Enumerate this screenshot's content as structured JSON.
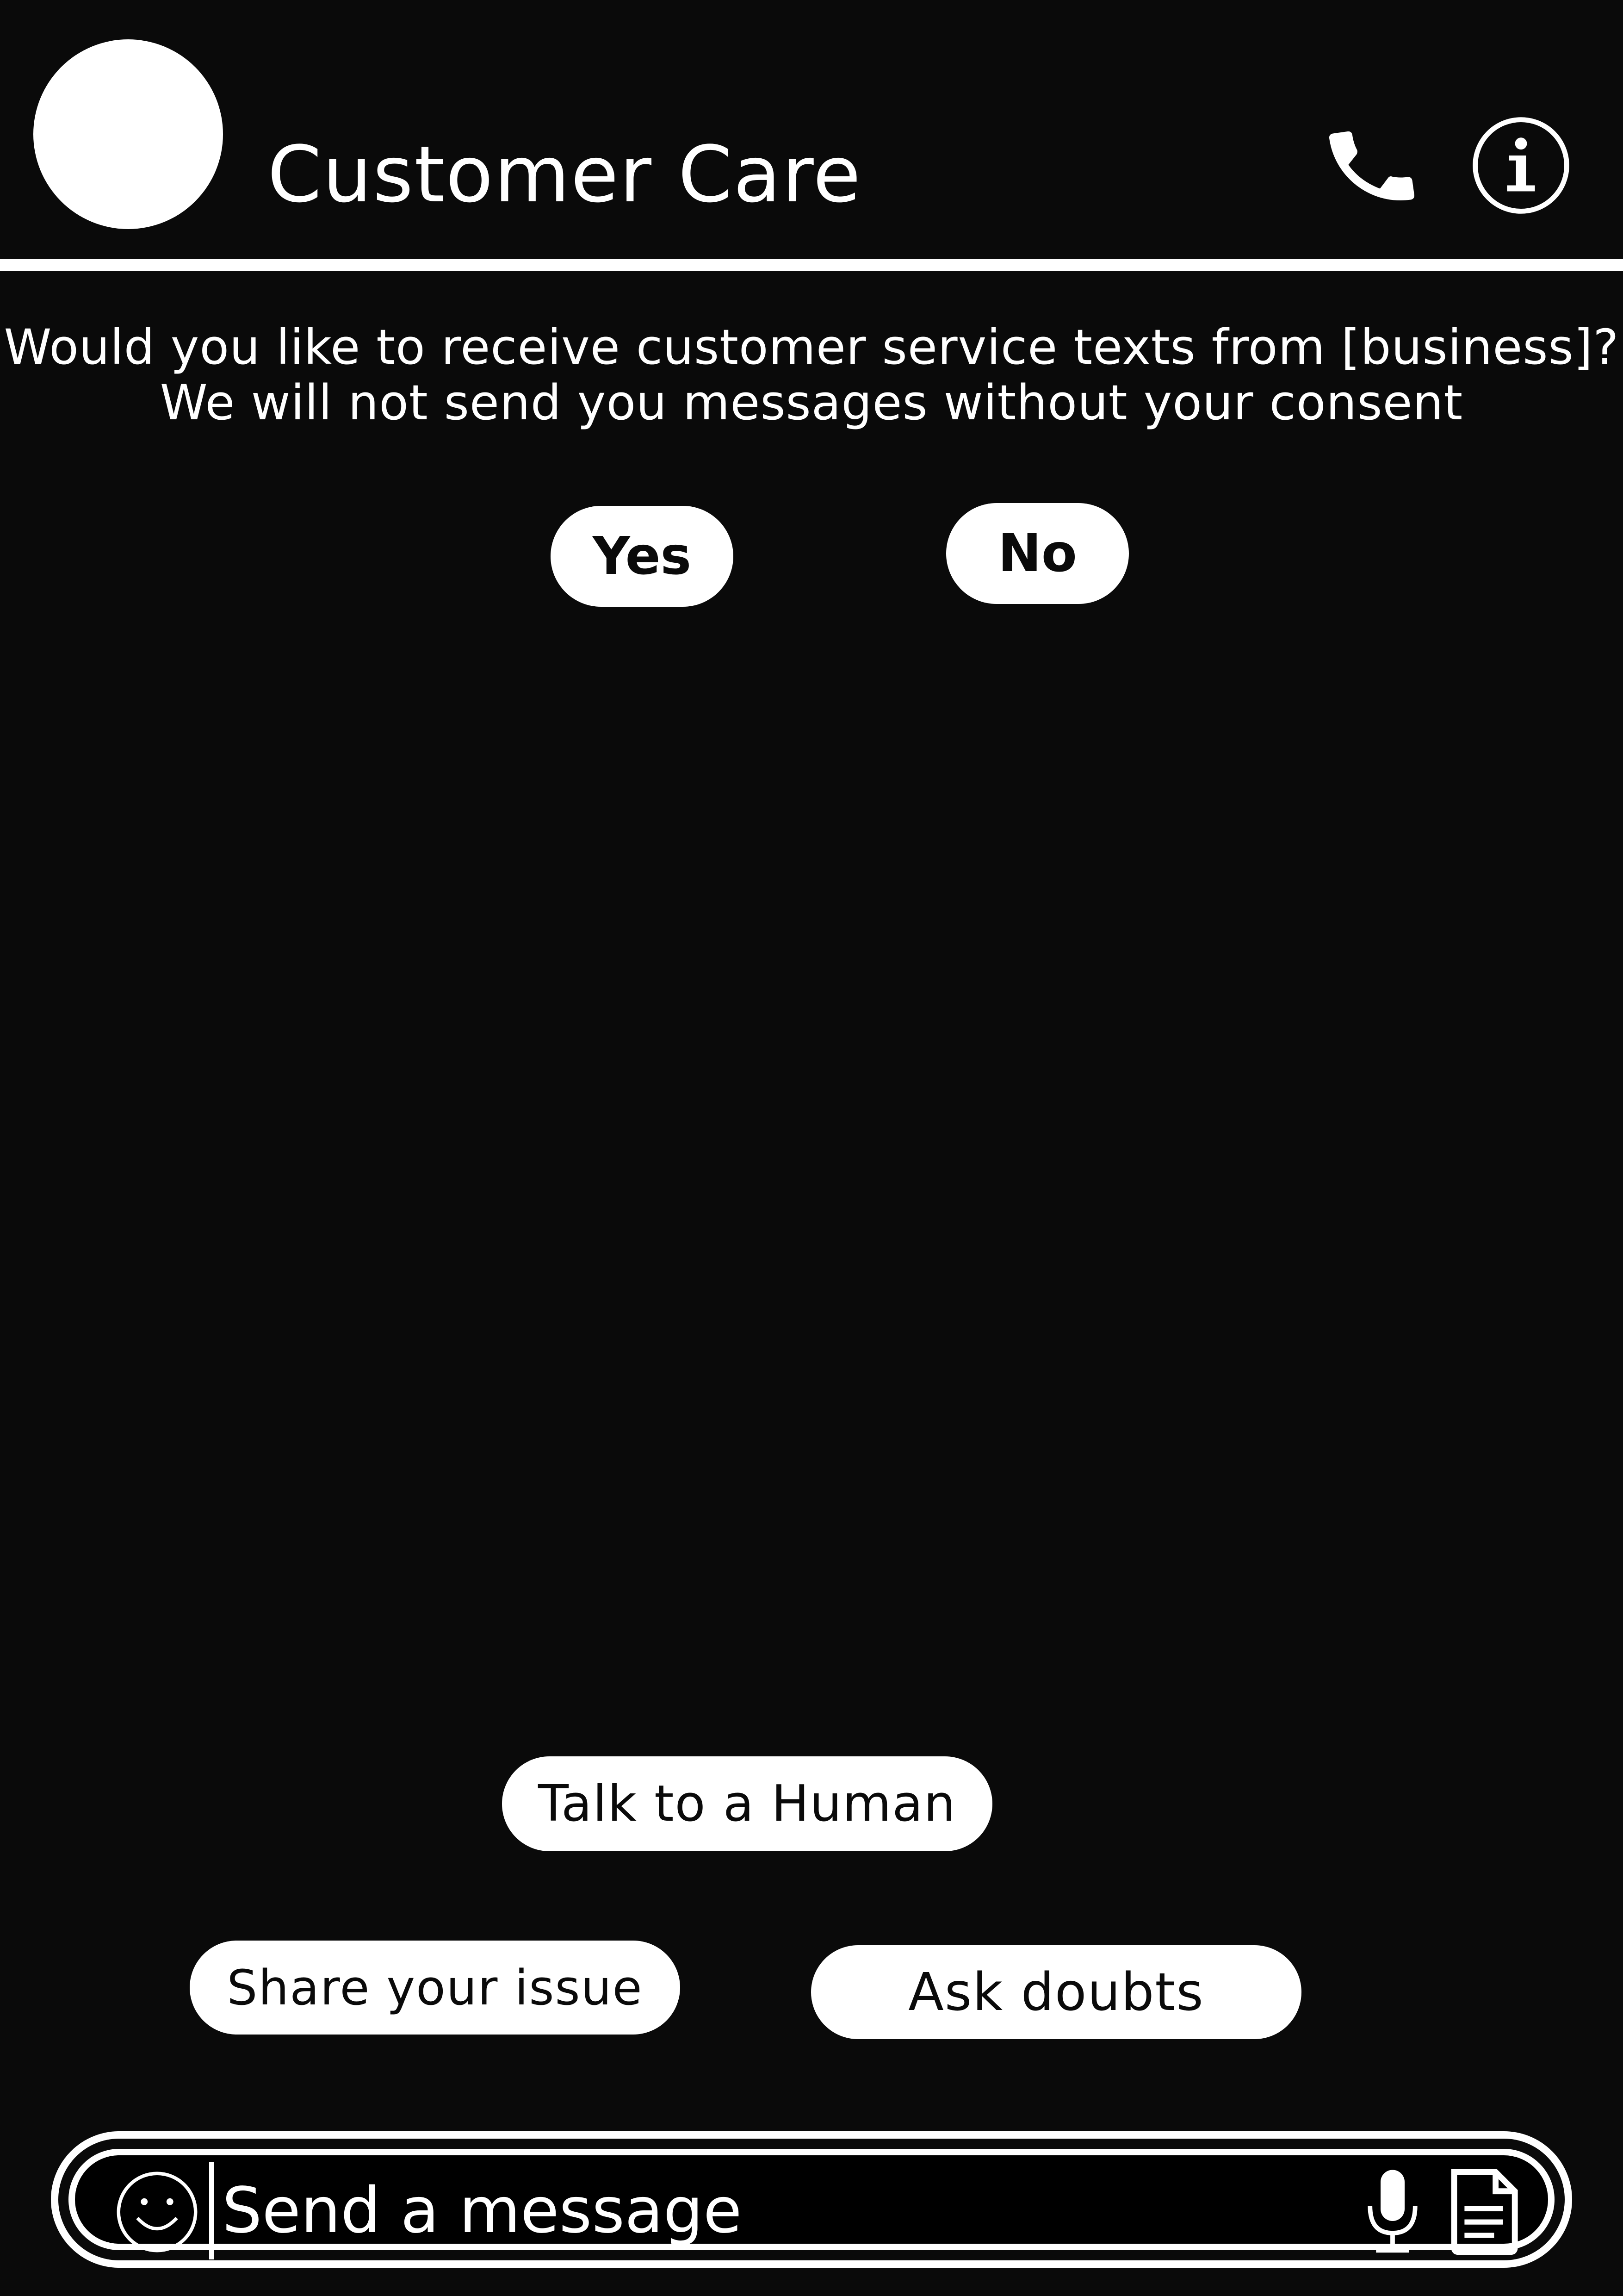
{
  "header": {
    "title": "Customer Care",
    "icons": {
      "call": "phone-icon",
      "info": "info-icon",
      "avatar": "avatar"
    }
  },
  "consent": {
    "line1": "Would you like to receive customer service texts from [business]?",
    "line2": "We will not send you messages without your consent",
    "yes_label": "Yes",
    "no_label": "No"
  },
  "quick_replies": {
    "human": "Talk to a Human",
    "issue": "Share your issue",
    "doubts": "Ask doubts"
  },
  "composer": {
    "placeholder": "Send a message",
    "icons": {
      "emoji": "smiley-icon",
      "mic": "microphone-icon",
      "attach": "document-icon"
    }
  },
  "colors": {
    "background": "#0a0a0a",
    "foreground": "#ffffff",
    "button_text": "#0a0a0a"
  }
}
